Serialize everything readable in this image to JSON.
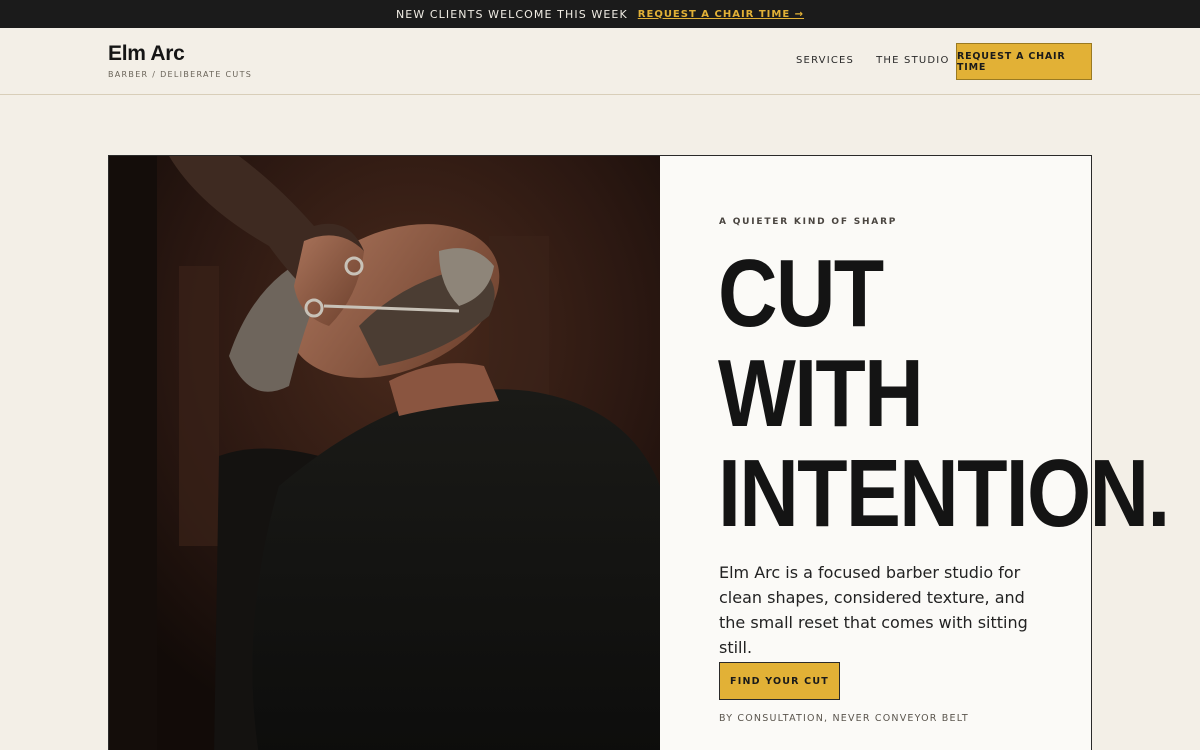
{
  "announcement": {
    "message": "NEW CLIENTS WELCOME THIS WEEK",
    "cta_label": "REQUEST A CHAIR TIME →"
  },
  "header": {
    "brand_name": "Elm Arc",
    "brand_tagline": "BARBER / DELIBERATE CUTS",
    "nav": [
      "SERVICES",
      "THE STUDIO"
    ],
    "cta_label": "REQUEST A CHAIR TIME"
  },
  "hero": {
    "eyebrow": "A QUIETER KIND OF SHARP",
    "headline_lines": [
      "CUT",
      "WITH",
      "INTENTION."
    ],
    "lede": "Elm Arc is a focused barber studio for clean shapes, considered texture, and the small reset that comes with sitting still.",
    "primary_cta": "FIND YOUR CUT",
    "note": "BY CONSULTATION, NEVER CONVEYOR BELT",
    "image_icon": "barber-photo"
  },
  "colors": {
    "accent": "#e2b136",
    "dark": "#1b1b1b",
    "background": "#f3efe7",
    "panel": "#fbfaf7"
  }
}
